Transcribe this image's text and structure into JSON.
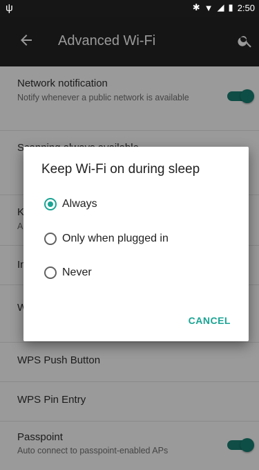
{
  "status": {
    "time": "2:50"
  },
  "appbar": {
    "title": "Advanced Wi-Fi"
  },
  "list": [
    {
      "title": "Network notification",
      "subtitle": "Notify whenever a public network is available",
      "toggle": true
    },
    {
      "title": "Scanning always available",
      "subtitle": ""
    },
    {
      "title": "K",
      "subtitle": "A"
    },
    {
      "title": "In",
      "subtitle": ""
    },
    {
      "title": "W",
      "subtitle": ""
    },
    {
      "title": "WPS Push Button",
      "subtitle": ""
    },
    {
      "title": "WPS Pin Entry",
      "subtitle": ""
    },
    {
      "title": "Passpoint",
      "subtitle": "Auto connect to passpoint-enabled APs",
      "toggle": true
    }
  ],
  "dialog": {
    "title": "Keep Wi-Fi on during sleep",
    "options": [
      {
        "label": "Always",
        "selected": true
      },
      {
        "label": "Only when plugged in",
        "selected": false
      },
      {
        "label": "Never",
        "selected": false
      }
    ],
    "cancel": "CANCEL"
  },
  "colors": {
    "accent": "#1aa494",
    "toggle": "#0d4e46",
    "appbar": "#151515",
    "dim": "#9a9a9a"
  }
}
